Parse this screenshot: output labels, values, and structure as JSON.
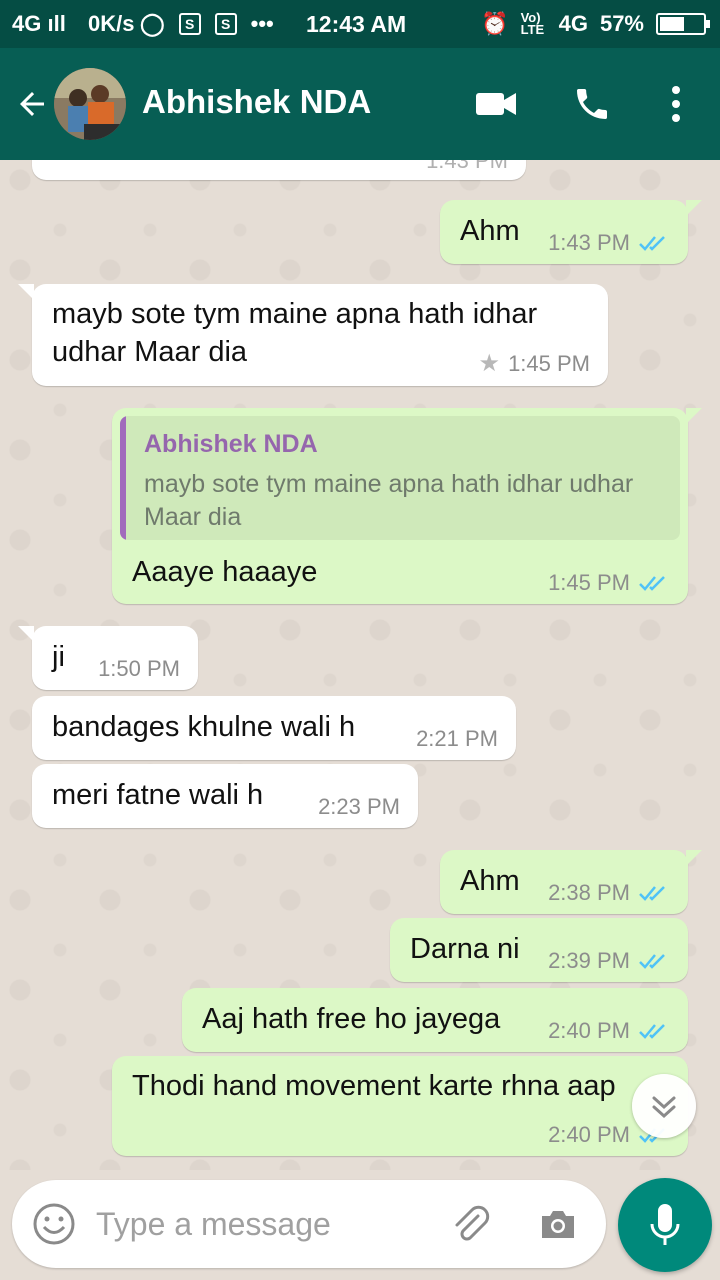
{
  "status_bar": {
    "network": "4G",
    "speed": "0K/s",
    "time": "12:43 AM",
    "lte_label": "Vo) LTE",
    "network2": "4G",
    "battery": "57%",
    "battery_level": 0.57
  },
  "header": {
    "contact_name": "Abhishek NDA"
  },
  "messages": [
    {
      "dir": "in",
      "text": "",
      "time": "1:43 PM",
      "partial": true
    },
    {
      "dir": "out",
      "text": "Ahm",
      "time": "1:43 PM",
      "ticks": "read"
    },
    {
      "dir": "in",
      "text_lines": [
        "mayb sote tym maine apna hath idhar",
        "udhar Maar dia"
      ],
      "time": "1:45 PM",
      "starred": true
    },
    {
      "dir": "out",
      "quote_name": "Abhishek NDA",
      "quote_text": "mayb sote tym maine apna hath idhar udhar Maar dia",
      "text": "Aaaye haaaye",
      "time": "1:45 PM",
      "ticks": "read"
    },
    {
      "dir": "in",
      "text": "ji",
      "time": "1:50 PM"
    },
    {
      "dir": "in",
      "text": "bandages khulne wali h",
      "time": "2:21 PM"
    },
    {
      "dir": "in",
      "text": "meri fatne wali h",
      "time": "2:23 PM"
    },
    {
      "dir": "out",
      "text": "Ahm",
      "time": "2:38 PM",
      "ticks": "read"
    },
    {
      "dir": "out",
      "text": "Darna ni",
      "time": "2:39 PM",
      "ticks": "read"
    },
    {
      "dir": "out",
      "text": "Aaj hath free ho jayega",
      "time": "2:40 PM",
      "ticks": "read"
    },
    {
      "dir": "out",
      "text": "Thodi hand movement karte rhna aap",
      "time": "2:40 PM",
      "ticks": "read"
    }
  ],
  "input": {
    "placeholder": "Type a message"
  },
  "colors": {
    "header": "#075e54",
    "status_bar": "#054d44",
    "outgoing_bubble": "#dcf8c6",
    "incoming_bubble": "#ffffff",
    "read_ticks": "#4fc3f7",
    "accent": "#00897b"
  },
  "icons": [
    "back-arrow-icon",
    "video-call-icon",
    "phone-icon",
    "more-options-icon",
    "star-icon",
    "double-tick-icon",
    "scroll-down-icon",
    "emoji-icon",
    "attach-icon",
    "camera-icon",
    "mic-icon"
  ]
}
